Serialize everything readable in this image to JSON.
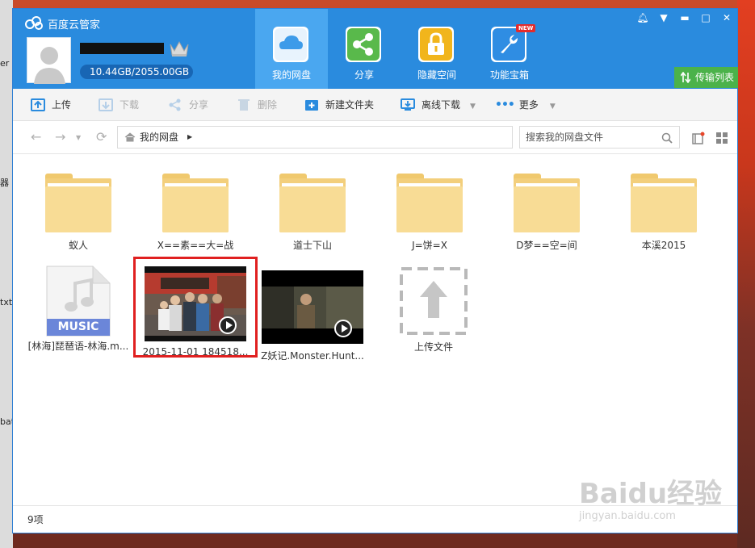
{
  "app": {
    "title": "百度云管家"
  },
  "user": {
    "storage": "10.44GB/2055.00GB"
  },
  "nav": [
    {
      "label": "我的网盘",
      "icon": "cloud-drive-icon"
    },
    {
      "label": "分享",
      "icon": "share-icon"
    },
    {
      "label": "隐藏空间",
      "icon": "lock-icon"
    },
    {
      "label": "功能宝箱",
      "icon": "toolbox-icon",
      "badge": "NEW"
    }
  ],
  "transfer_list": "传输列表",
  "toolbar": {
    "upload": "上传",
    "download": "下载",
    "share": "分享",
    "delete": "删除",
    "new_folder": "新建文件夹",
    "offline_download": "离线下载",
    "more": "更多"
  },
  "breadcrumb": {
    "current": "我的网盘"
  },
  "search": {
    "placeholder": "搜索我的网盘文件"
  },
  "files": [
    {
      "name": "蚁人",
      "type": "folder"
    },
    {
      "name": "X==素==大=战",
      "type": "folder"
    },
    {
      "name": "道士下山",
      "type": "folder"
    },
    {
      "name": "J=饼=X",
      "type": "folder"
    },
    {
      "name": "D梦==空=间",
      "type": "folder"
    },
    {
      "name": "本溪2015",
      "type": "folder"
    },
    {
      "name": "[林海]琵琶语-林海.m...",
      "type": "music",
      "tag": "MUSIC"
    },
    {
      "name": "2015-11-01 184518...",
      "type": "video",
      "selected": true
    },
    {
      "name": "Z妖记.Monster.Hunt...",
      "type": "video"
    },
    {
      "name": "上传文件",
      "type": "upload"
    }
  ],
  "status": {
    "count": "9项"
  },
  "desktop": {
    "left_labels": [
      "er",
      "器",
      "txt",
      "bat"
    ]
  },
  "watermark": {
    "text": "Baidu经验",
    "sub": "jingyan.baidu.com"
  },
  "colors": {
    "title_bar": "#2a8bde",
    "active_tab": "#4aa7f0",
    "transfer_btn": "#4bb24a",
    "selection": "#e02020",
    "folder": "#f3cf7c"
  }
}
